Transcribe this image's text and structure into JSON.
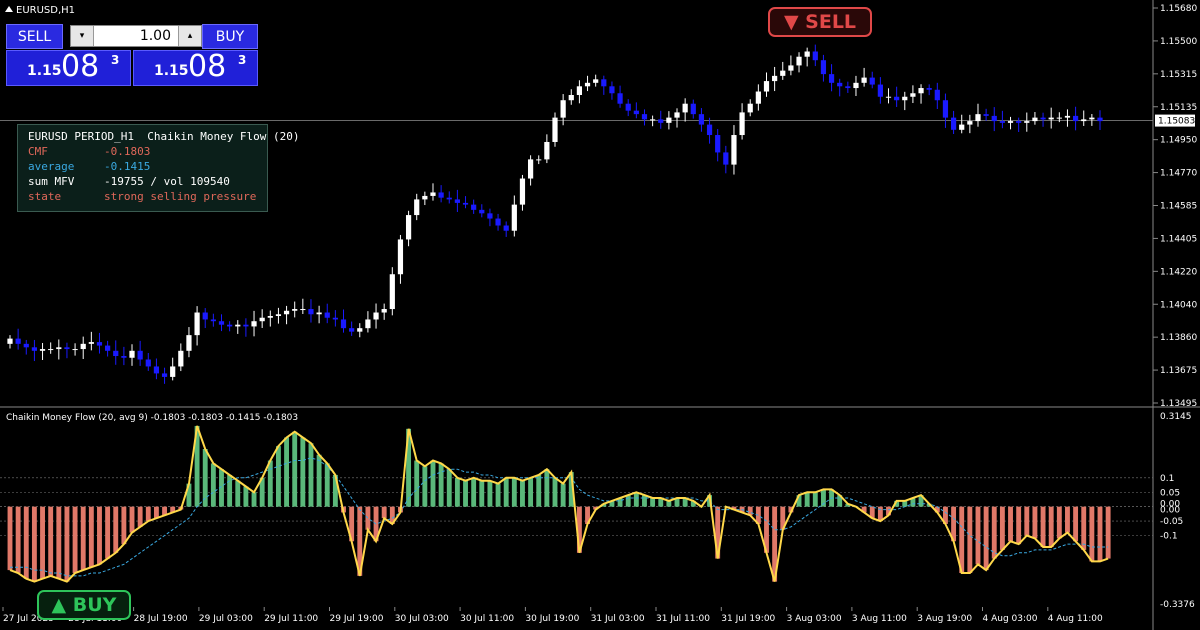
{
  "window": {
    "title": "EURUSD,H1",
    "title_icon": "triangle-up-icon"
  },
  "trade_panel": {
    "sell_label": "SELL",
    "buy_label": "BUY",
    "lot_value": "1.00",
    "sell_price": {
      "small": "1.15",
      "big": "08",
      "sup": "3"
    },
    "buy_price": {
      "small": "1.15",
      "big": "08",
      "sup": "3"
    }
  },
  "info_panel": {
    "rows": [
      {
        "key": "EURUSD PERIOD_H1",
        "value": "Chaikin Money Flow (20)",
        "color": "#ffffff"
      },
      {
        "key": "CMF",
        "value": "-0.1803",
        "color": "#e0685a"
      },
      {
        "key": "average",
        "value": "-0.1415",
        "color": "#3aa8e0"
      },
      {
        "key": "sum MFV",
        "value": "-19755 / vol 109540",
        "color": "#ffffff"
      },
      {
        "key": "state",
        "value": "strong selling pressure",
        "color": "#e0685a"
      }
    ]
  },
  "signals": {
    "sell": {
      "label": "▼ SELL",
      "color": "#e04848"
    },
    "buy": {
      "label": "▲ BUY",
      "color": "#2ec45a"
    }
  },
  "colors": {
    "background": "#000000",
    "bull_candle": "#ffffff",
    "bear_candle": "#1a1aff",
    "cmf_positive": "#5ab87a",
    "cmf_negative": "#e07868",
    "cmf_line": "#ffd84a",
    "avg_line": "#3aa8e0",
    "axis_text": "#ffffff",
    "current_price_line": "#aaaaaa"
  },
  "chart_data": [
    {
      "type": "candlestick",
      "title": "EURUSD,H1",
      "ylim": [
        1.1346,
        1.1573
      ],
      "y_ticks": [
        "1.15680",
        "1.15500",
        "1.15315",
        "1.15135",
        "1.14950",
        "1.14770",
        "1.14585",
        "1.14405",
        "1.14220",
        "1.14040",
        "1.13860",
        "1.13675",
        "1.13495"
      ],
      "current_price": "1.15083",
      "x_labels": [
        "27 Jul 2025",
        "28 Jul 11:00",
        "28 Jul 19:00",
        "29 Jul 03:00",
        "29 Jul 11:00",
        "29 Jul 19:00",
        "30 Jul 03:00",
        "30 Jul 11:00",
        "30 Jul 19:00",
        "31 Jul 03:00",
        "31 Jul 11:00",
        "31 Jul 19:00",
        "3 Aug 03:00",
        "3 Aug 11:00",
        "3 Aug 19:00",
        "4 Aug 03:00",
        "4 Aug 11:00"
      ],
      "close": [
        1.1383,
        1.138,
        1.1378,
        1.1376,
        1.1377,
        1.1377,
        1.1378,
        1.1377,
        1.1377,
        1.138,
        1.1381,
        1.1379,
        1.1376,
        1.1373,
        1.1372,
        1.1376,
        1.1371,
        1.1367,
        1.1363,
        1.1361,
        1.1367,
        1.1376,
        1.1385,
        1.1398,
        1.1394,
        1.1393,
        1.1391,
        1.139,
        1.1391,
        1.139,
        1.1393,
        1.1395,
        1.1396,
        1.1397,
        1.1399,
        1.14,
        1.14,
        1.1397,
        1.1398,
        1.1395,
        1.1394,
        1.1389,
        1.1387,
        1.1389,
        1.1394,
        1.1398,
        1.14,
        1.142,
        1.144,
        1.1454,
        1.1463,
        1.1465,
        1.1467,
        1.1464,
        1.1463,
        1.1461,
        1.146,
        1.1457,
        1.1455,
        1.1452,
        1.1448,
        1.1445,
        1.146,
        1.1475,
        1.1486,
        1.1486,
        1.1496,
        1.151,
        1.152,
        1.1523,
        1.1528,
        1.153,
        1.1532,
        1.1528,
        1.1524,
        1.1518,
        1.1514,
        1.1512,
        1.1509,
        1.1509,
        1.1507,
        1.151,
        1.1513,
        1.1518,
        1.1512,
        1.1506,
        1.15,
        1.149,
        1.1483,
        1.15,
        1.1513,
        1.1518,
        1.1525,
        1.1531,
        1.1534,
        1.1537,
        1.154,
        1.1545,
        1.1548,
        1.1543,
        1.1535,
        1.153,
        1.1528,
        1.1527,
        1.153,
        1.1533,
        1.1529,
        1.1522,
        1.1522,
        1.152,
        1.1522,
        1.1524,
        1.1527,
        1.1526,
        1.152,
        1.151,
        1.1503,
        1.1506,
        1.1508,
        1.1512,
        1.1511,
        1.1508,
        1.1507,
        1.1508,
        1.1507,
        1.1508,
        1.151,
        1.1509,
        1.151,
        1.151,
        1.1511,
        1.1508,
        1.1509,
        1.151,
        1.1508
      ]
    },
    {
      "type": "bar",
      "title": "Chaikin Money Flow (20, avg 9) -0.1803 -0.1803 -0.1415 -0.1803",
      "ylim": [
        -0.3376,
        0.3145
      ],
      "y_ticks": [
        "0.3145",
        "0.1",
        "0.05",
        "0.00",
        "0.00",
        "-0.05",
        "-0.1",
        "-0.3376"
      ],
      "cmf": [
        -0.22,
        -0.23,
        -0.25,
        -0.26,
        -0.25,
        -0.24,
        -0.25,
        -0.26,
        -0.23,
        -0.22,
        -0.21,
        -0.2,
        -0.18,
        -0.16,
        -0.13,
        -0.09,
        -0.07,
        -0.05,
        -0.04,
        -0.03,
        -0.02,
        -0.01,
        0.08,
        0.28,
        0.2,
        0.15,
        0.13,
        0.11,
        0.09,
        0.07,
        0.05,
        0.1,
        0.16,
        0.21,
        0.24,
        0.26,
        0.24,
        0.22,
        0.18,
        0.15,
        0.11,
        -0.02,
        -0.12,
        -0.24,
        -0.08,
        -0.12,
        -0.04,
        -0.06,
        -0.02,
        0.27,
        0.16,
        0.14,
        0.16,
        0.15,
        0.13,
        0.1,
        0.09,
        0.1,
        0.09,
        0.09,
        0.08,
        0.1,
        0.1,
        0.09,
        0.1,
        0.11,
        0.13,
        0.1,
        0.08,
        0.12,
        -0.16,
        -0.06,
        -0.01,
        0.01,
        0.02,
        0.03,
        0.04,
        0.05,
        0.04,
        0.03,
        0.03,
        0.02,
        0.03,
        0.03,
        0.02,
        0.0,
        0.04,
        -0.18,
        0.0,
        -0.01,
        -0.02,
        -0.03,
        -0.06,
        -0.16,
        -0.26,
        -0.08,
        -0.02,
        0.04,
        0.05,
        0.05,
        0.06,
        0.06,
        0.04,
        0.01,
        0.0,
        -0.02,
        -0.04,
        -0.05,
        -0.03,
        0.02,
        0.02,
        0.03,
        0.04,
        0.01,
        -0.02,
        -0.06,
        -0.12,
        -0.23,
        -0.23,
        -0.2,
        -0.22,
        -0.18,
        -0.15,
        -0.12,
        -0.13,
        -0.1,
        -0.11,
        -0.14,
        -0.14,
        -0.11,
        -0.09,
        -0.12,
        -0.15,
        -0.19,
        -0.19,
        -0.18
      ],
      "average": [
        -0.21,
        -0.21,
        -0.21,
        -0.22,
        -0.22,
        -0.23,
        -0.23,
        -0.24,
        -0.24,
        -0.24,
        -0.23,
        -0.23,
        -0.22,
        -0.21,
        -0.2,
        -0.18,
        -0.16,
        -0.14,
        -0.12,
        -0.1,
        -0.08,
        -0.06,
        -0.04,
        0.0,
        0.03,
        0.05,
        0.07,
        0.09,
        0.1,
        0.1,
        0.11,
        0.12,
        0.13,
        0.14,
        0.15,
        0.16,
        0.16,
        0.17,
        0.16,
        0.14,
        0.11,
        0.07,
        0.03,
        -0.01,
        -0.04,
        -0.06,
        -0.05,
        -0.04,
        -0.02,
        0.03,
        0.06,
        0.09,
        0.11,
        0.12,
        0.13,
        0.13,
        0.12,
        0.12,
        0.11,
        0.11,
        0.1,
        0.1,
        0.1,
        0.1,
        0.1,
        0.1,
        0.1,
        0.1,
        0.1,
        0.1,
        0.06,
        0.04,
        0.03,
        0.02,
        0.02,
        0.02,
        0.03,
        0.03,
        0.03,
        0.03,
        0.03,
        0.03,
        0.03,
        0.03,
        0.03,
        0.02,
        0.02,
        -0.01,
        -0.01,
        -0.01,
        -0.01,
        -0.02,
        -0.03,
        -0.05,
        -0.08,
        -0.08,
        -0.07,
        -0.05,
        -0.03,
        -0.01,
        0.01,
        0.03,
        0.03,
        0.03,
        0.02,
        0.01,
        0.0,
        -0.01,
        -0.01,
        -0.01,
        0.0,
        0.01,
        0.01,
        0.01,
        0.0,
        -0.02,
        -0.04,
        -0.07,
        -0.1,
        -0.12,
        -0.14,
        -0.16,
        -0.17,
        -0.17,
        -0.16,
        -0.16,
        -0.15,
        -0.15,
        -0.15,
        -0.14,
        -0.13,
        -0.13,
        -0.13,
        -0.14,
        -0.14,
        -0.14
      ]
    }
  ]
}
